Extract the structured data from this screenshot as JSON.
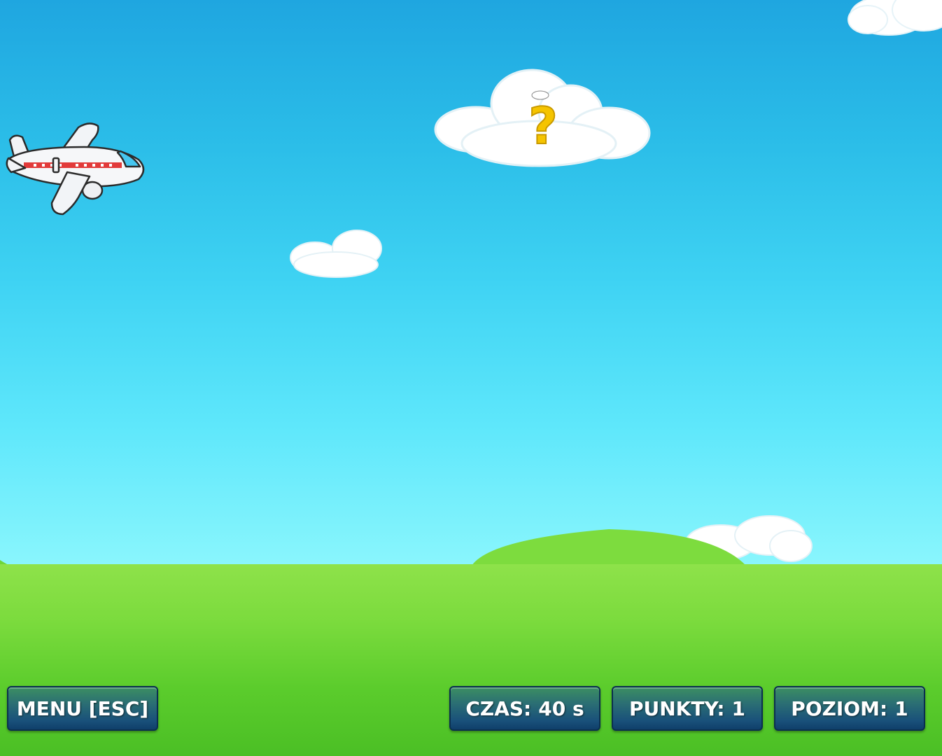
{
  "hud": {
    "menu_label": "MENU [ESC]",
    "time_label": "CZAS:",
    "time_value": "40 s",
    "points_label": "PUNKTY:",
    "points_value": "1",
    "level_label": "POZIOM:",
    "level_value": "1"
  },
  "scene": {
    "mystery_symbol": "?",
    "colors": {
      "sky_top": "#1fa6e0",
      "sky_bottom": "#8af6fd",
      "grass": "#6fd63a",
      "hill": "#7ddc3e",
      "cloud": "#ffffff",
      "question_mark": "#f5c400",
      "button_top": "#3c8f62",
      "button_bottom": "#0f3f6a"
    },
    "icons": [
      "airplane-icon",
      "question-cloud-icon",
      "cloud-icon",
      "hill-icon"
    ]
  }
}
